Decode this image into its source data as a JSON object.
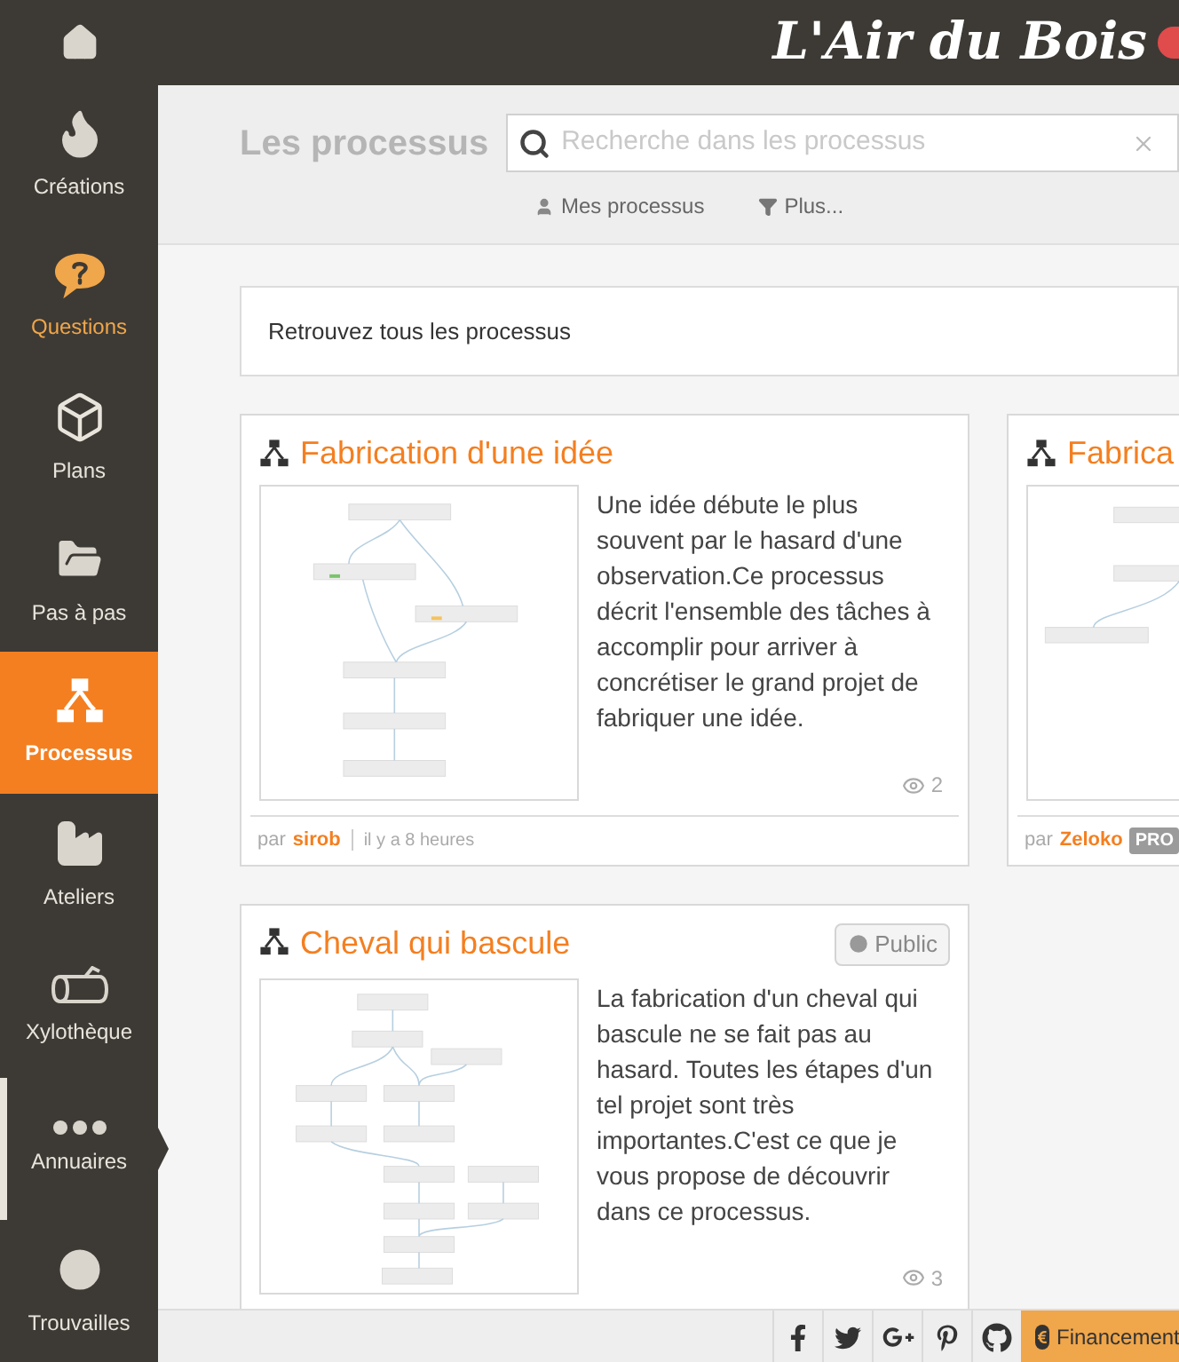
{
  "header": {
    "logo": "L'Air du Bois"
  },
  "sidebar": {
    "items": [
      {
        "kind": "creations",
        "label": "Créations",
        "selected": false,
        "highlighted": false,
        "open": false
      },
      {
        "kind": "questions",
        "label": "Questions",
        "selected": false,
        "highlighted": true,
        "open": false
      },
      {
        "kind": "plans",
        "label": "Plans",
        "selected": false,
        "highlighted": false,
        "open": false
      },
      {
        "kind": "steps",
        "label": "Pas à pas",
        "selected": false,
        "highlighted": false,
        "open": false
      },
      {
        "kind": "process",
        "label": "Processus",
        "selected": true,
        "highlighted": false,
        "open": false
      },
      {
        "kind": "workshops",
        "label": "Ateliers",
        "selected": false,
        "highlighted": false,
        "open": false
      },
      {
        "kind": "wood",
        "label": "Xylothèque",
        "selected": false,
        "highlighted": false,
        "open": false
      },
      {
        "kind": "directory",
        "label": "Annuaires",
        "selected": false,
        "highlighted": false,
        "open": true
      },
      {
        "kind": "finds",
        "label": "Trouvailles",
        "selected": false,
        "highlighted": false,
        "open": false
      }
    ]
  },
  "toolbar": {
    "title": "Les processus",
    "search": {
      "placeholder": "Recherche dans les processus"
    },
    "filters": [
      {
        "kind": "user",
        "label": "Mes processus"
      },
      {
        "kind": "filter",
        "label": "Plus..."
      }
    ]
  },
  "intro": "Retrouvez tous les processus",
  "cards": [
    {
      "title": "Fabrication d'une idée",
      "description": "Une idée débute le plus souvent par le hasard d'une observation.Ce processus décrit l'ensemble des tâches à accomplir pour arriver à concrétiser le grand projet de fabriquer une idée.",
      "views": "2",
      "by": "par",
      "author": "sirob",
      "time": "il y a 8 heures"
    },
    {
      "title": "Fabrica",
      "by": "par",
      "author": "Zeloko",
      "badge": "PRO"
    },
    {
      "title": "Cheval qui bascule",
      "visibility": "Public",
      "description": "La fabrication d'un cheval qui bascule ne se fait pas au hasard. Toutes les étapes d'un tel projet sont très importantes.C'est ce que je vous propose de découvrir dans ce processus.",
      "views": "3"
    }
  ],
  "footer": {
    "social": [
      {
        "kind": "facebook"
      },
      {
        "kind": "twitter"
      },
      {
        "kind": "googleplus"
      },
      {
        "kind": "pinterest"
      },
      {
        "kind": "github"
      }
    ],
    "funding": "Financement"
  }
}
